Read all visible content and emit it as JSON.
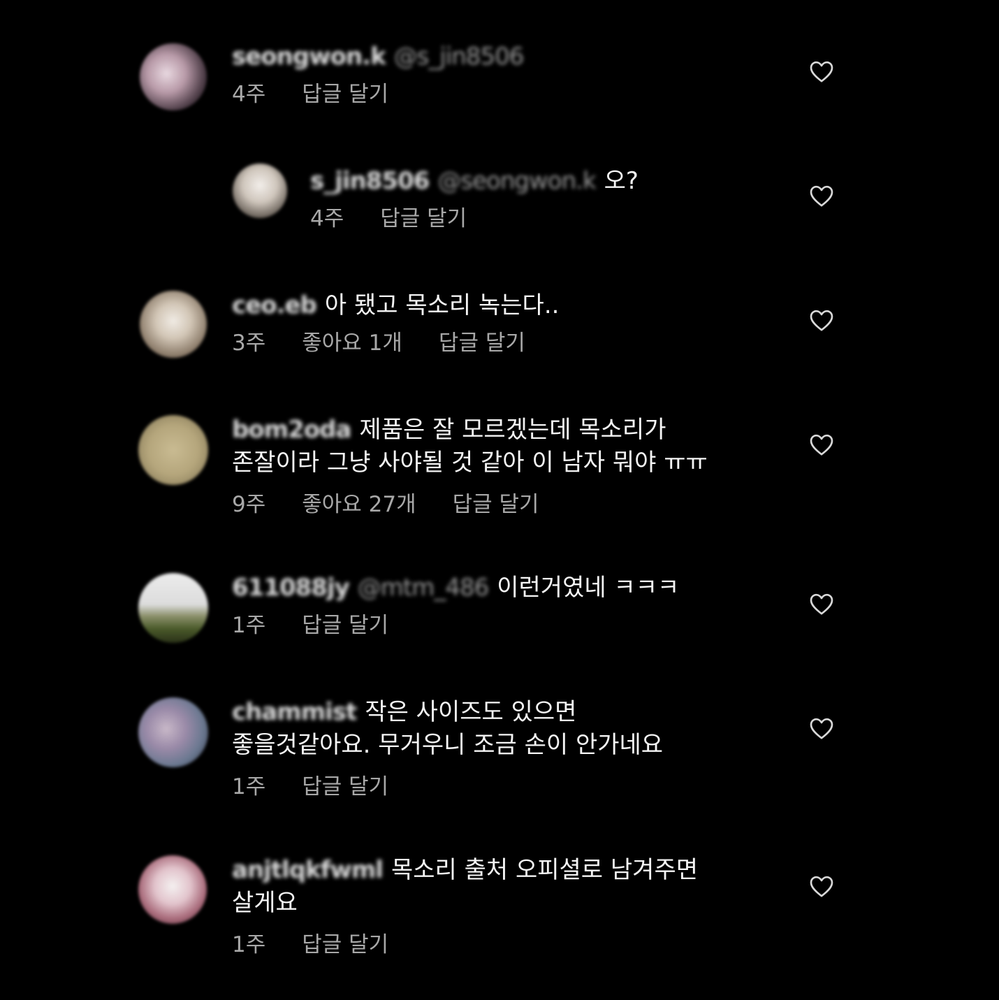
{
  "colors": {
    "background": "#000000",
    "text": "#f5f5f5",
    "meta": "#a8a8a8",
    "mention": "#9a9a9a"
  },
  "comments": [
    {
      "username": "seongwon.k",
      "mention": "@s_jin8506",
      "text": "",
      "text2": "",
      "time": "4주",
      "likes": "",
      "reply": "답글 달기",
      "icon": "heart-outline-icon"
    },
    {
      "username": "s_jin8506",
      "mention": "@seongwon.k",
      "text": "오?",
      "text2": "",
      "time": "4주",
      "likes": "",
      "reply": "답글 달기",
      "icon": "heart-outline-icon"
    },
    {
      "username": "ceo.eb",
      "mention": "",
      "text": "아 됐고 목소리 녹는다..",
      "text2": "",
      "time": "3주",
      "likes": "좋아요 1개",
      "reply": "답글 달기",
      "icon": "heart-outline-icon"
    },
    {
      "username": "bom2oda",
      "mention": "",
      "text": "제품은 잘 모르겠는데 목소리가",
      "text2": "존잘이라 그냥 사야될 것 같아 이 남자 뭐야 ㅠㅠ",
      "time": "9주",
      "likes": "좋아요 27개",
      "reply": "답글 달기",
      "icon": "heart-outline-icon"
    },
    {
      "username": "611088jy",
      "mention": "@mtm_486",
      "text": "이런거였네 ㅋㅋㅋ",
      "text2": "",
      "time": "1주",
      "likes": "",
      "reply": "답글 달기",
      "icon": "heart-outline-icon"
    },
    {
      "username": "chammist",
      "mention": "",
      "text": "작은 사이즈도 있으면",
      "text2": "좋을것같아요. 무거우니 조금 손이 안가네요",
      "time": "1주",
      "likes": "",
      "reply": "답글 달기",
      "icon": "heart-outline-icon"
    },
    {
      "username": "anjtlqkfwml",
      "mention": "",
      "text": "목소리 출처 오피셜로 남겨주면",
      "text2": "살게요",
      "time": "1주",
      "likes": "",
      "reply": "답글 달기",
      "icon": "heart-outline-icon"
    }
  ]
}
